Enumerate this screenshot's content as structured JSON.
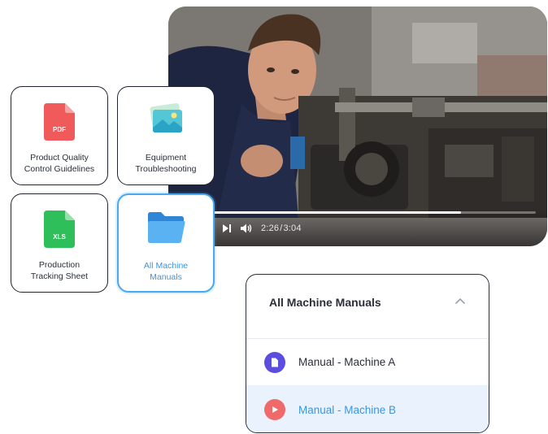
{
  "video": {
    "current_time": "2:26",
    "separator": "/",
    "duration": "3:04",
    "progress": 0.79
  },
  "cards": {
    "pdf": {
      "badge": "PDF",
      "label_line1": "Product Quality",
      "label_line2": "Control Guidelines"
    },
    "image": {
      "label_line1": "Equipment",
      "label_line2": "Troubleshooting"
    },
    "xls": {
      "badge": "XLS",
      "label_line1": "Production",
      "label_line2": "Tracking Sheet"
    },
    "folder": {
      "label_line1": "All Machine",
      "label_line2": "Manuals"
    }
  },
  "panel": {
    "title": "All Machine Manuals",
    "items": [
      {
        "label": "Manual - Machine A",
        "icon": "document-icon",
        "color": "#5b4de0"
      },
      {
        "label": "Manual - Machine B",
        "icon": "play-icon",
        "color": "#ef6a6a"
      }
    ]
  },
  "colors": {
    "accent": "#3b95e0",
    "selected_border": "#4aa8f0",
    "pdf_red": "#f05a5a",
    "xls_green": "#2fbf5a",
    "folder_blue": "#4aa8f0"
  }
}
